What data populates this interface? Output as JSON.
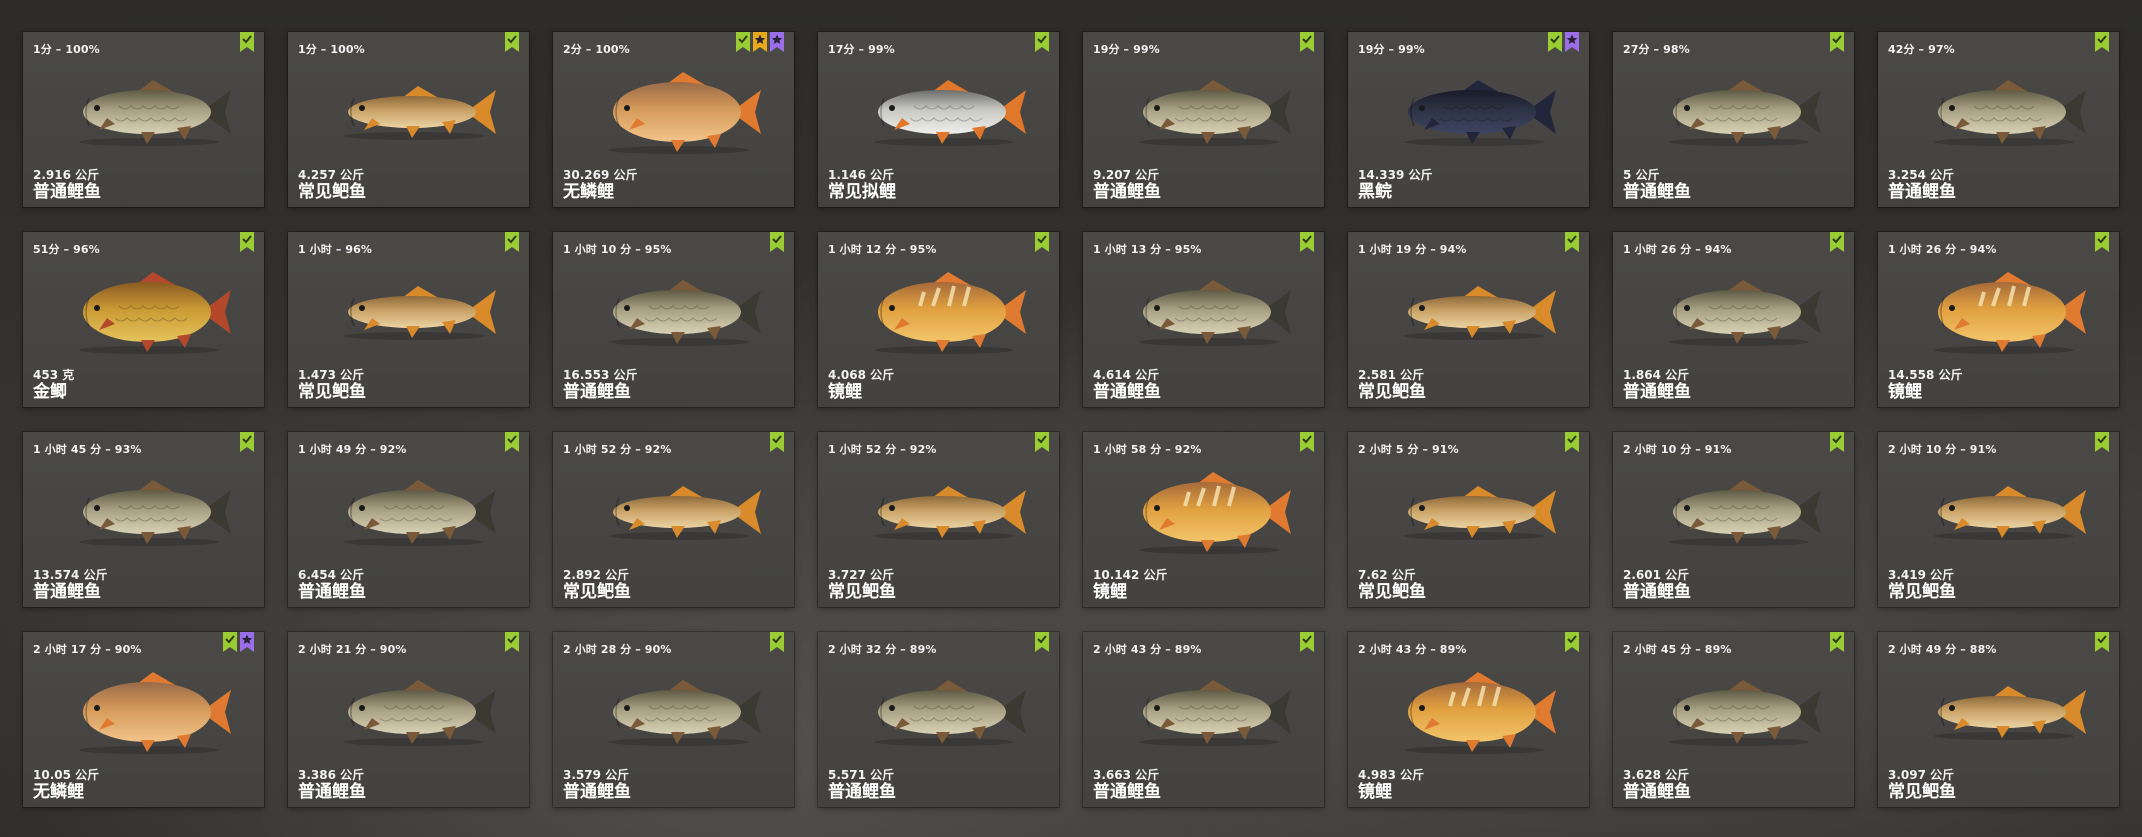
{
  "colors": {
    "green": "#9acd34",
    "gold": "#e8a91a",
    "purple": "#9a6ee6"
  },
  "cards": [
    {
      "time": "1分 – 100%",
      "weight": "2.916 公斤",
      "name": "普通鲤鱼",
      "kind": "common",
      "badges": [
        "check"
      ]
    },
    {
      "time": "1分 – 100%",
      "weight": "4.257 公斤",
      "name": "常见鲃鱼",
      "kind": "barbel",
      "badges": [
        "check"
      ]
    },
    {
      "time": "2分 – 100%",
      "weight": "30.269 公斤",
      "name": "无鳞鲤",
      "kind": "leather",
      "badges": [
        "check",
        "star",
        "star-purple"
      ]
    },
    {
      "time": "17分 – 99%",
      "weight": "1.146 公斤",
      "name": "常见拟鲤",
      "kind": "roach",
      "badges": [
        "check"
      ]
    },
    {
      "time": "19分 – 99%",
      "weight": "9.207 公斤",
      "name": "普通鲤鱼",
      "kind": "common",
      "badges": [
        "check"
      ]
    },
    {
      "time": "19分 – 99%",
      "weight": "14.339 公斤",
      "name": "黑鲩",
      "kind": "black",
      "badges": [
        "check",
        "star-purple"
      ]
    },
    {
      "time": "27分 – 98%",
      "weight": "5 公斤",
      "name": "普通鲤鱼",
      "kind": "common",
      "badges": [
        "check"
      ]
    },
    {
      "time": "42分 – 97%",
      "weight": "3.254 公斤",
      "name": "普通鲤鱼",
      "kind": "common",
      "badges": [
        "check"
      ]
    },
    {
      "time": "51分 – 96%",
      "weight": "453 克",
      "name": "金鲫",
      "kind": "crucian",
      "badges": [
        "check"
      ]
    },
    {
      "time": "1 小时 – 96%",
      "weight": "1.473 公斤",
      "name": "常见鲃鱼",
      "kind": "barbel",
      "badges": [
        "check"
      ]
    },
    {
      "time": "1 小时 10 分 – 95%",
      "weight": "16.553 公斤",
      "name": "普通鲤鱼",
      "kind": "common",
      "badges": [
        "check"
      ]
    },
    {
      "time": "1 小时 12 分 – 95%",
      "weight": "4.068 公斤",
      "name": "镜鲤",
      "kind": "mirror",
      "badges": [
        "check"
      ]
    },
    {
      "time": "1 小时 13 分 – 95%",
      "weight": "4.614 公斤",
      "name": "普通鲤鱼",
      "kind": "common",
      "badges": [
        "check"
      ]
    },
    {
      "time": "1 小时 19 分 – 94%",
      "weight": "2.581 公斤",
      "name": "常见鲃鱼",
      "kind": "barbel",
      "badges": [
        "check"
      ]
    },
    {
      "time": "1 小时 26 分 – 94%",
      "weight": "1.864 公斤",
      "name": "普通鲤鱼",
      "kind": "common",
      "badges": [
        "check"
      ]
    },
    {
      "time": "1 小时 26 分 – 94%",
      "weight": "14.558 公斤",
      "name": "镜鲤",
      "kind": "mirror",
      "badges": [
        "check"
      ]
    },
    {
      "time": "1 小时 45 分 – 93%",
      "weight": "13.574 公斤",
      "name": "普通鲤鱼",
      "kind": "common",
      "badges": [
        "check"
      ]
    },
    {
      "time": "1 小时 49 分 – 92%",
      "weight": "6.454 公斤",
      "name": "普通鲤鱼",
      "kind": "common",
      "badges": [
        "check"
      ]
    },
    {
      "time": "1 小时 52 分 – 92%",
      "weight": "2.892 公斤",
      "name": "常见鲃鱼",
      "kind": "barbel",
      "badges": [
        "check"
      ]
    },
    {
      "time": "1 小时 52 分 – 92%",
      "weight": "3.727 公斤",
      "name": "常见鲃鱼",
      "kind": "barbel",
      "badges": [
        "check"
      ]
    },
    {
      "time": "1 小时 58 分 – 92%",
      "weight": "10.142 公斤",
      "name": "镜鲤",
      "kind": "mirror",
      "badges": [
        "check"
      ]
    },
    {
      "time": "2 小时 5 分 – 91%",
      "weight": "7.62 公斤",
      "name": "常见鲃鱼",
      "kind": "barbel",
      "badges": [
        "check"
      ]
    },
    {
      "time": "2 小时 10 分 – 91%",
      "weight": "2.601 公斤",
      "name": "普通鲤鱼",
      "kind": "common",
      "badges": [
        "check"
      ]
    },
    {
      "time": "2 小时 10 分 – 91%",
      "weight": "3.419 公斤",
      "name": "常见鲃鱼",
      "kind": "barbel",
      "badges": [
        "check"
      ]
    },
    {
      "time": "2 小时 17 分 – 90%",
      "weight": "10.05 公斤",
      "name": "无鳞鲤",
      "kind": "leather",
      "badges": [
        "check",
        "star-purple"
      ]
    },
    {
      "time": "2 小时 21 分 – 90%",
      "weight": "3.386 公斤",
      "name": "普通鲤鱼",
      "kind": "common",
      "badges": [
        "check"
      ]
    },
    {
      "time": "2 小时 28 分 – 90%",
      "weight": "3.579 公斤",
      "name": "普通鲤鱼",
      "kind": "common",
      "badges": [
        "check"
      ]
    },
    {
      "time": "2 小时 32 分 – 89%",
      "weight": "5.571 公斤",
      "name": "普通鲤鱼",
      "kind": "common",
      "badges": [
        "check"
      ]
    },
    {
      "time": "2 小时 43 分 – 89%",
      "weight": "3.663 公斤",
      "name": "普通鲤鱼",
      "kind": "common",
      "badges": [
        "check"
      ]
    },
    {
      "time": "2 小时 43 分 – 89%",
      "weight": "4.983 公斤",
      "name": "镜鲤",
      "kind": "mirror",
      "badges": [
        "check"
      ]
    },
    {
      "time": "2 小时 45 分 – 89%",
      "weight": "3.628 公斤",
      "name": "普通鲤鱼",
      "kind": "common",
      "badges": [
        "check"
      ]
    },
    {
      "time": "2 小时 49 分 – 88%",
      "weight": "3.097 公斤",
      "name": "常见鲃鱼",
      "kind": "barbel",
      "badges": [
        "check"
      ]
    }
  ]
}
